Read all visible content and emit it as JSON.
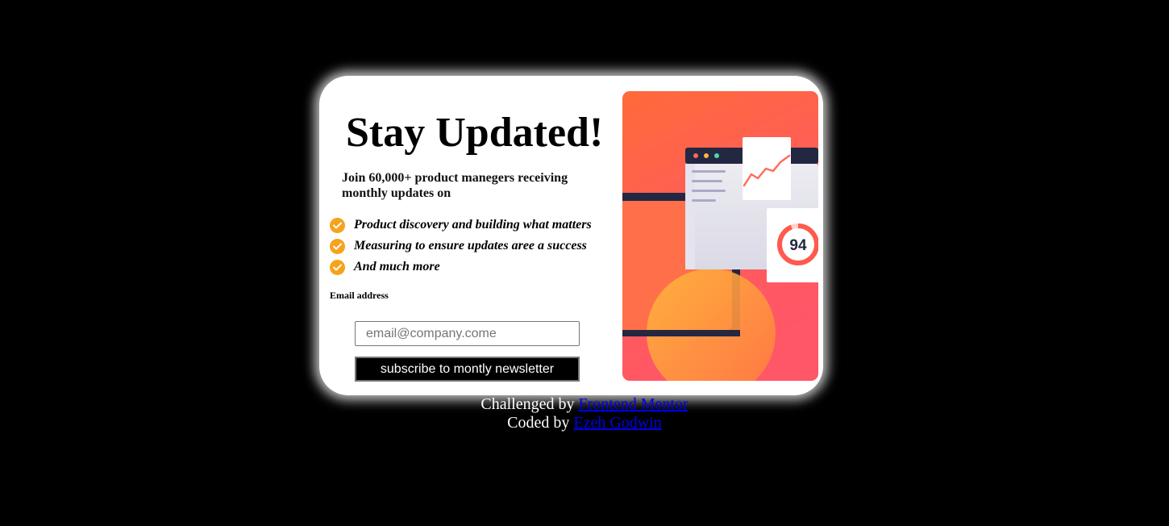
{
  "card": {
    "title": "Stay Updated!",
    "intro": "Join 60,000+ product manegers receiving monthly updates on",
    "features": [
      "Product discovery and building what matters",
      "Measuring to ensure updates aree a success",
      "And much more"
    ],
    "email_label": "Email address",
    "email_placeholder": "email@company.come",
    "email_value": "",
    "subscribe_label": "subscribe to montly newsletter",
    "illustration": {
      "score": "94",
      "icon": "dashboard-illustration"
    }
  },
  "footer": {
    "challenged_prefix": "Challenged by ",
    "challenged_link": "Frontend Mentor",
    "coded_prefix": "Coded by ",
    "coded_link": "Ezeh Godwin"
  },
  "colors": {
    "background": "#000000",
    "card": "#ffffff",
    "check": "#f7a21c",
    "button": "#000000",
    "link": "#0000ee",
    "illustration_top": "#ff6a3a",
    "illustration_bottom": "#ff5270"
  }
}
